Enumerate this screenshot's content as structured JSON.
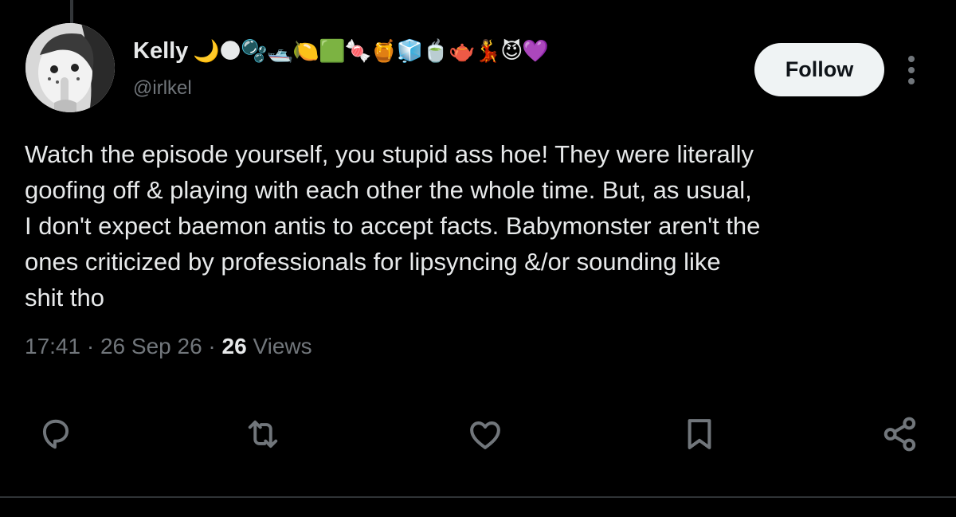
{
  "author": {
    "display_name": "Kelly",
    "name_emojis": "🌙🌑🫧🛥️🍋🟩🍬🍯🧊🍵🫖💃😈💜",
    "handle": "@irlkel"
  },
  "follow_button": {
    "label": "Follow"
  },
  "tweet": {
    "text": "Watch the episode yourself, you stupid ass hoe! They were literally\ngoofing off & playing with each other the whole time. But, as usual,\nI don't expect baemon antis to accept facts. Babymonster aren't the\nones criticized by professionals for lipsyncing &/or sounding like\nshit tho",
    "time": "17:41",
    "date": "26 Sep 26",
    "views_count": "26",
    "views_label": "Views",
    "separator": "·"
  },
  "actions": [
    {
      "name": "reply-icon"
    },
    {
      "name": "repost-icon"
    },
    {
      "name": "like-icon"
    },
    {
      "name": "bookmark-icon"
    },
    {
      "name": "share-icon"
    }
  ],
  "colors": {
    "background": "#000000",
    "primary_text": "#e7e9ea",
    "secondary_text": "#71767b",
    "follow_bg": "#eff3f4",
    "follow_text": "#0f1419",
    "divider": "#2f3336"
  }
}
